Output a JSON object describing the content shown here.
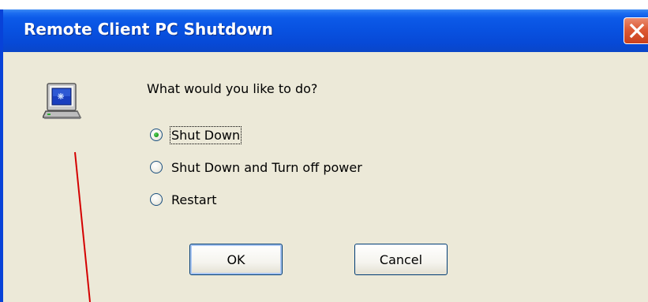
{
  "window": {
    "title": "Remote Client PC Shutdown"
  },
  "dialog": {
    "prompt": "What would you like to do?",
    "options": [
      {
        "label": "Shut Down",
        "selected": true
      },
      {
        "label": "Shut Down and Turn off power",
        "selected": false
      },
      {
        "label": "Restart",
        "selected": false
      }
    ],
    "ok_label": "OK",
    "cancel_label": "Cancel"
  },
  "colors": {
    "titlebar": "#0851e0",
    "client_bg": "#ece9d8",
    "close_button": "#dd5a35",
    "annotation_line": "#d40000"
  },
  "icons": {
    "app_icon": "computer-monitor-icon",
    "close": "close-icon"
  }
}
